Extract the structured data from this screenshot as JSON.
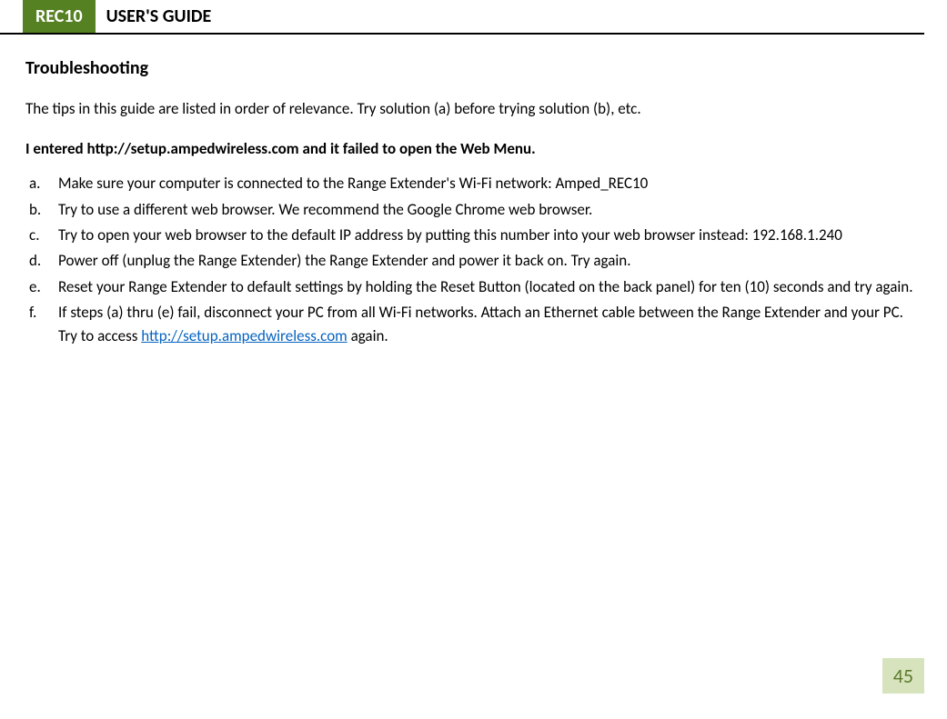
{
  "header": {
    "badge": "REC10",
    "title": "USER'S GUIDE"
  },
  "section_title": "Troubleshooting",
  "intro": "The tips in this guide are listed in order of relevance. Try solution (a) before trying solution (b), etc.",
  "issue_heading": "I entered http://setup.ampedwireless.com and it failed to open the Web Menu.",
  "solutions": {
    "a": {
      "marker": "a.",
      "text": "Make sure your computer is connected to the Range Extender's Wi-Fi network: Amped_REC10"
    },
    "b": {
      "marker": "b.",
      "text": "Try to use a different web browser. We recommend the Google Chrome web browser."
    },
    "c": {
      "marker": "c.",
      "text": "Try to open your web browser to the default IP address by putting this number into your web browser instead: 192.168.1.240"
    },
    "d": {
      "marker": "d.",
      "text": "Power off (unplug the Range Extender) the Range Extender and power it back on. Try again."
    },
    "e": {
      "marker": "e.",
      "text": "Reset your Range Extender to default settings by holding the Reset Button (located on the back panel) for ten (10) seconds and try again."
    },
    "f": {
      "marker": "f.",
      "pre_text": "If steps (a) thru (e) fail, disconnect your PC from all Wi-Fi networks. Attach an Ethernet cable between the Range Extender and your PC. Try to access ",
      "link_text": "http://setup.ampedwireless.com",
      "post_text": " again."
    }
  },
  "page_number": "45"
}
